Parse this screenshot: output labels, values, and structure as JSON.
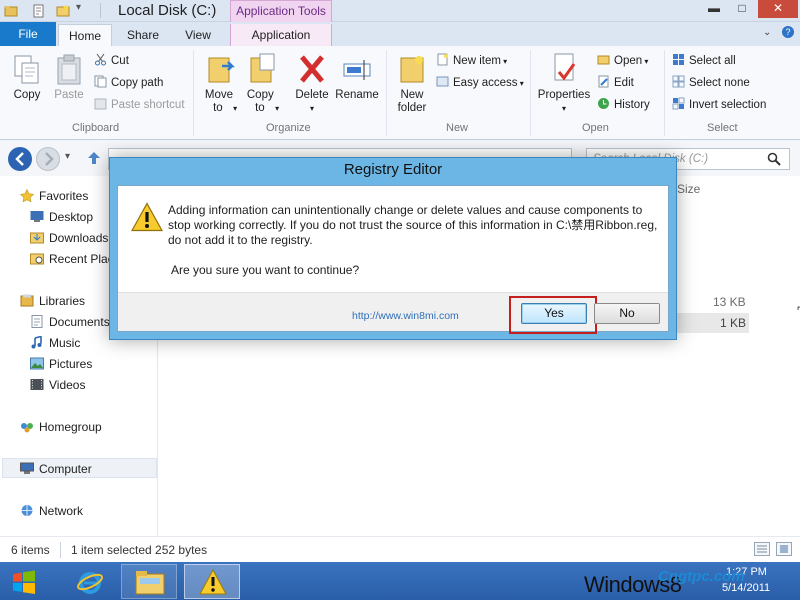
{
  "window": {
    "title": "Local Disk (C:)",
    "context_tab_title": "Application Tools",
    "minimize": "▬",
    "maximize": "□",
    "close": "✕"
  },
  "tabs": {
    "file": "File",
    "home": "Home",
    "share": "Share",
    "view": "View",
    "application": "Application"
  },
  "ribbon": {
    "clipboard": {
      "label": "Clipboard",
      "copy": "Copy",
      "paste": "Paste",
      "cut": "Cut",
      "copy_path": "Copy path",
      "paste_shortcut": "Paste shortcut"
    },
    "organize": {
      "label": "Organize",
      "move_to": "Move to",
      "copy_to": "Copy to",
      "delete": "Delete",
      "rename": "Rename"
    },
    "new": {
      "label": "New",
      "new_folder": "New folder",
      "new_item": "New item",
      "easy_access": "Easy access"
    },
    "open": {
      "label": "Open",
      "properties": "Properties",
      "open": "Open",
      "edit": "Edit",
      "history": "History"
    },
    "select": {
      "label": "Select",
      "select_all": "Select all",
      "select_none": "Select none",
      "invert_selection": "Invert selection"
    }
  },
  "address": {
    "search_placeholder": "Search Local Disk (C:)"
  },
  "nav": {
    "favorites": "Favorites",
    "desktop": "Desktop",
    "downloads": "Downloads",
    "recent_places": "Recent Places",
    "libraries": "Libraries",
    "documents": "Documents",
    "music": "Music",
    "pictures": "Pictures",
    "videos": "Videos",
    "homegroup": "Homegroup",
    "computer": "Computer",
    "network": "Network"
  },
  "filelist": {
    "size_header": "Size",
    "row1_size": "13 KB",
    "row2_size": "1 KB"
  },
  "status": {
    "item_count": "6 items",
    "selection": "1 item selected  252 bytes"
  },
  "dialog": {
    "title": "Registry Editor",
    "message": "Adding information can unintentionally change or delete values and cause components to stop working correctly. If you do not trust the source of this information in C:\\禁用Ribbon.reg, do not add it to the registry.",
    "question": "Are you sure you want to continue?",
    "yes": "Yes",
    "no": "No"
  },
  "watermark": {
    "logo": "Win8Mi",
    "url": "http://www.win8mi.com",
    "bottom_text": "Windows8",
    "bottom_brand": "Cngtpc.com"
  },
  "taskbar": {
    "time": "1:27 PM",
    "date": "5/14/2011"
  },
  "colors": {
    "accent_blue": "#1979ca",
    "context_purple": "#6b2c87",
    "dialog_frame": "#6cb6e6",
    "highlight_red": "#c41e1e"
  }
}
